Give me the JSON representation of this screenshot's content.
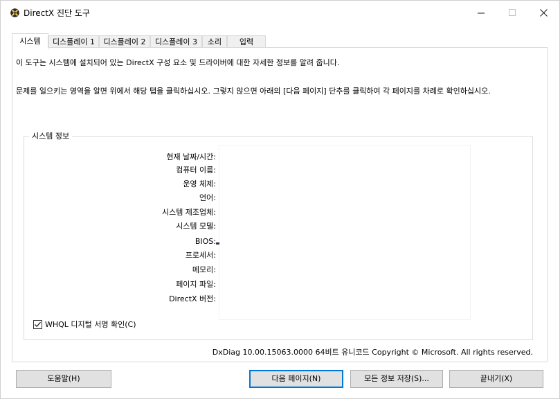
{
  "window": {
    "title": "DirectX 진단 도구",
    "minimize_glyph": "—",
    "colors": {
      "accent": "#0078d7",
      "button_bg": "#e1e1e1",
      "tab_bg": "#f0f0f0"
    }
  },
  "tabs": [
    {
      "label": "시스템",
      "active": true
    },
    {
      "label": "디스플레이 1",
      "active": false
    },
    {
      "label": "디스플레이 2",
      "active": false
    },
    {
      "label": "디스플레이 3",
      "active": false
    },
    {
      "label": "소리",
      "active": false
    },
    {
      "label": "입력",
      "active": false
    }
  ],
  "content": {
    "intro": "이 도구는 시스템에 설치되어 있는 DirectX 구성 요소 및 드라이버에 대한 자세한 정보를 알려 줍니다.",
    "description": "문제를 일으키는 영역을 알면 위에서 해당 탭을 클릭하십시오. 그렇지 않으면 아래의 [다음 페이지] 단추를 클릭하여 각 페이지를 차례로 확인하십시오."
  },
  "system_info": {
    "group_title": "시스템 정보",
    "labels": [
      "현재 날짜/시간:",
      "컴퓨터 이름:",
      "운영 체제:",
      "언어:",
      "시스템 제조업체:",
      "시스템 모델:",
      "BIOS:",
      "프로세서:",
      "메모리:",
      "페이지 파일:",
      "DirectX 버전:"
    ]
  },
  "whql": {
    "label": "WHQL 디지털 서명 확인(C)",
    "checked": true
  },
  "footer": {
    "version_text": "DxDiag 10.00.15063.0000 64비트 유니코드  Copyright © Microsoft. All rights reserved.",
    "buttons": {
      "help": "도움말(H)",
      "next_page": "다음 페이지(N)",
      "save_all": "모든 정보 저장(S)...",
      "exit": "끝내기(X)"
    }
  }
}
